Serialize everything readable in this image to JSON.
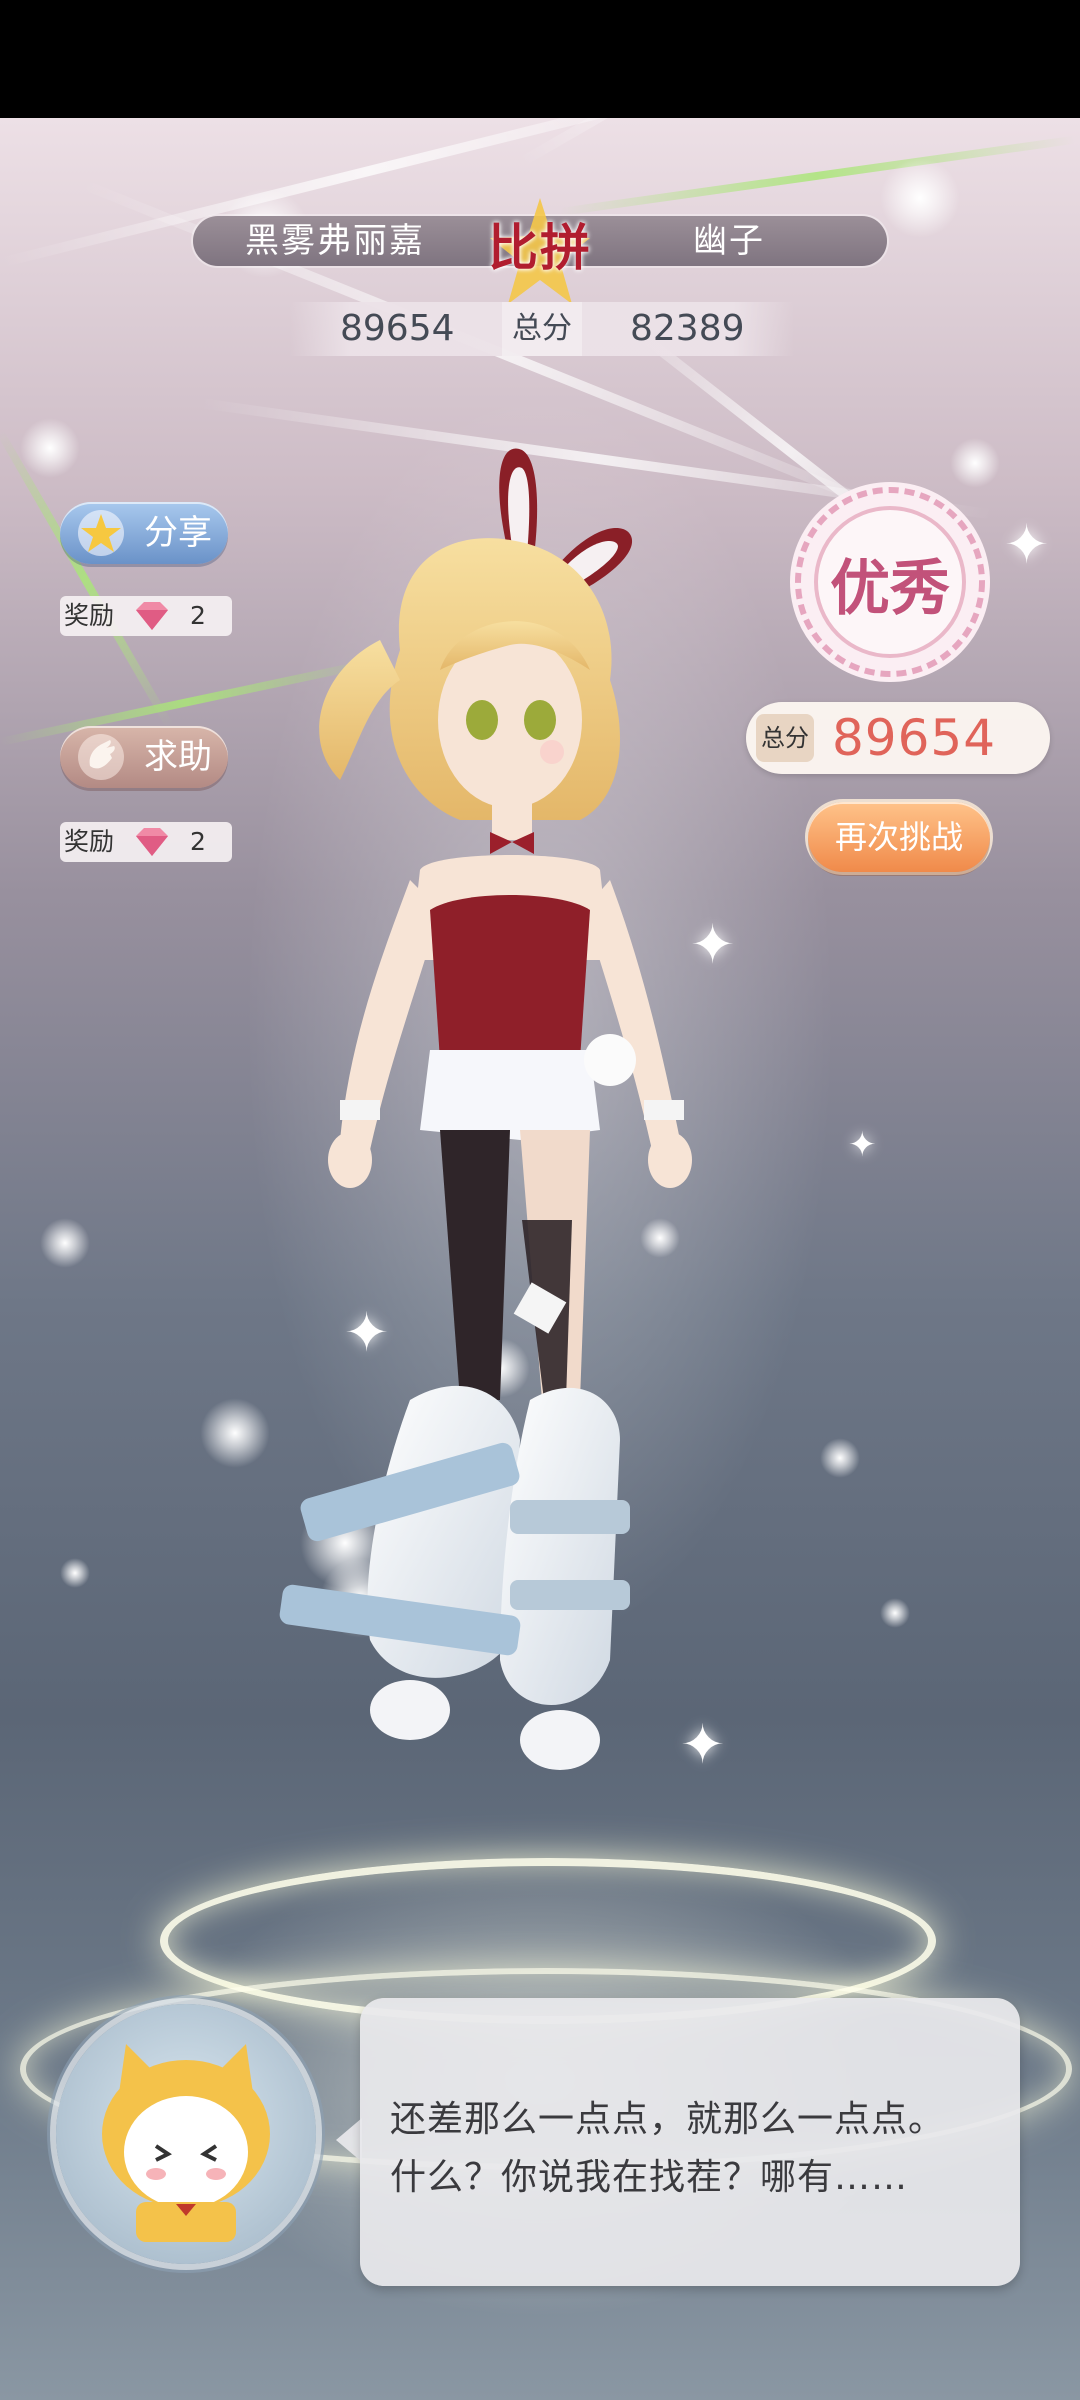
{
  "versus": {
    "player_left": "黑雾弗丽嘉",
    "label": "比拼",
    "player_right": "幽子",
    "score_left": "89654",
    "score_label": "总分",
    "score_right": "82389"
  },
  "actions": {
    "share_label": "分享",
    "share_reward_label": "奖励",
    "share_reward_count": "2",
    "help_label": "求助",
    "help_reward_label": "奖励",
    "help_reward_count": "2"
  },
  "result": {
    "rating": "优秀",
    "total_label": "总分",
    "total_value": "89654",
    "retry_label": "再次挑战"
  },
  "dialog": {
    "line1": "还差那么一点点，就那么一点点。",
    "line2": "什么？你说我在找茬？哪有……"
  },
  "colors": {
    "vs_label": "#b11d2f",
    "total_value": "#e0645a",
    "retry_button": "#f08a4a",
    "share_button": "#6a92c8",
    "help_button": "#b38a84"
  },
  "icons": {
    "share": "star-hand-icon",
    "help": "hand-icon",
    "reward": "gem-icon",
    "rating": "rosette-seal"
  }
}
